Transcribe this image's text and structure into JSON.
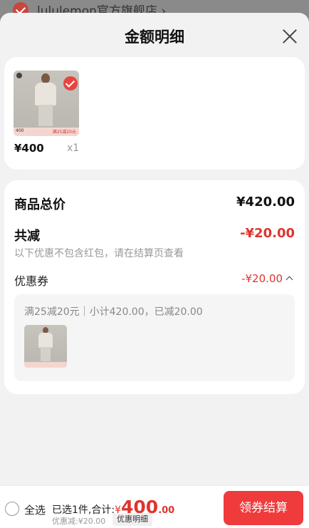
{
  "backdrop": {
    "store_name": "lululemon官方旗舰店 ›"
  },
  "sheet": {
    "title": "金额明细"
  },
  "product": {
    "price": "¥400",
    "quantity": "x1",
    "thumb_tag_price": "400",
    "thumb_tag_promo": "满25减20元"
  },
  "summary_card": {
    "total_label": "商品总价",
    "total_value": "¥420.00",
    "discount_label": "共减",
    "discount_value": "-¥20.00",
    "note": "以下优惠不包含红包，请在结算页查看",
    "coupon_label": "优惠券",
    "coupon_value": "-¥20.00",
    "coupon_desc": "满25减20元｜小计420.00，已减20.00"
  },
  "bottom_bar": {
    "select_all": "全选",
    "summary_prefix": "已选1件,合计:",
    "currency": "¥",
    "amount": "400",
    "cents": ".00",
    "discount_note": "优惠减:¥20.00",
    "detail_button": "优惠明细",
    "checkout_button": "领券结算"
  },
  "colors": {
    "accent": "#e0342f",
    "checkout_bg": "#ef3b3b"
  }
}
